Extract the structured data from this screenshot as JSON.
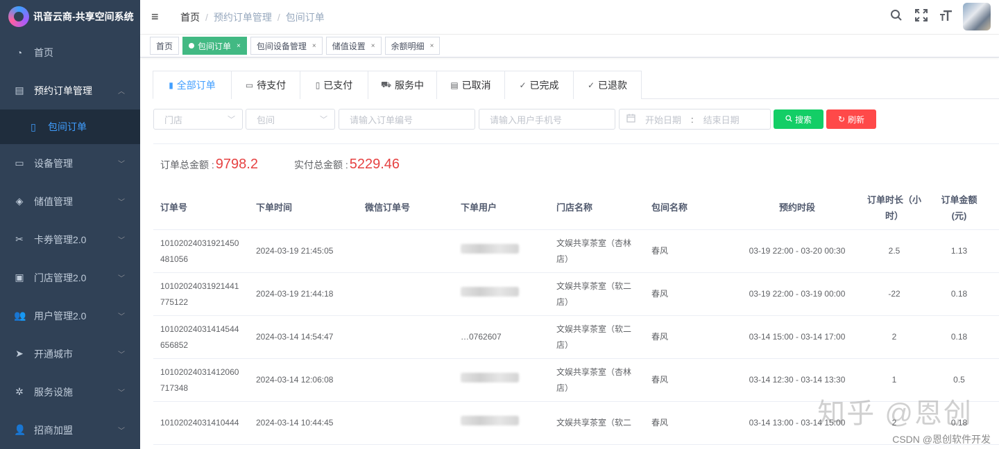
{
  "app": {
    "title": "讯音云商-共享空间系统"
  },
  "sidebar": {
    "items": [
      {
        "label": "首页",
        "icon": "dashboard-icon",
        "glyph": "◔"
      },
      {
        "label": "预约订单管理",
        "icon": "order-icon",
        "glyph": "▤",
        "open": true
      },
      {
        "label": "设备管理",
        "icon": "device-icon",
        "glyph": "▭"
      },
      {
        "label": "储值管理",
        "icon": "wallet-icon",
        "glyph": "◈"
      },
      {
        "label": "卡券管理2.0",
        "icon": "coupon-icon",
        "glyph": "✂"
      },
      {
        "label": "门店管理2.0",
        "icon": "store-icon",
        "glyph": "▣"
      },
      {
        "label": "用户管理2.0",
        "icon": "user-icon",
        "glyph": "👥"
      },
      {
        "label": "开通城市",
        "icon": "send-icon",
        "glyph": "➤"
      },
      {
        "label": "服务设施",
        "icon": "gear-icon",
        "glyph": "✲"
      },
      {
        "label": "招商加盟",
        "icon": "people-icon",
        "glyph": "👤"
      }
    ],
    "sub_item": {
      "label": "包间订单",
      "icon": "book-icon",
      "glyph": "▯"
    }
  },
  "header": {
    "breadcrumb": [
      "首页",
      "预约订单管理",
      "包间订单"
    ],
    "icons": [
      "search-icon",
      "fullscreen-icon",
      "font-size-icon"
    ]
  },
  "tags": [
    {
      "label": "首页",
      "active": false,
      "closable": false
    },
    {
      "label": "包间订单",
      "active": true,
      "closable": true
    },
    {
      "label": "包间设备管理",
      "active": false,
      "closable": true
    },
    {
      "label": "储值设置",
      "active": false,
      "closable": true
    },
    {
      "label": "余额明细",
      "active": false,
      "closable": true
    }
  ],
  "status_tabs": [
    {
      "label": "全部订单",
      "icon": "clipboard-icon",
      "glyph": "▮",
      "active": true
    },
    {
      "label": "待支付",
      "icon": "card-icon",
      "glyph": "▭"
    },
    {
      "label": "已支付",
      "icon": "receipt-icon",
      "glyph": "▯"
    },
    {
      "label": "服务中",
      "icon": "truck-icon",
      "glyph": "⛟"
    },
    {
      "label": "已取消",
      "icon": "document-icon",
      "glyph": "▤"
    },
    {
      "label": "已完成",
      "icon": "check-circle-icon",
      "glyph": "✓"
    },
    {
      "label": "已退款",
      "icon": "check-circle-icon",
      "glyph": "✓"
    }
  ],
  "filters": {
    "store_placeholder": "门店",
    "room_placeholder": "包间",
    "order_no_placeholder": "请输入订单编号",
    "phone_placeholder": "请输入用户手机号",
    "start_date_placeholder": "开始日期",
    "date_separator": ":",
    "end_date_placeholder": "结束日期",
    "search_label": "搜索",
    "refresh_label": "刷新"
  },
  "totals": {
    "order_total_label": "订单总金额 :",
    "order_total_value": "9798.2",
    "paid_total_label": "实付总金额 :",
    "paid_total_value": "5229.46"
  },
  "table": {
    "columns": [
      "订单号",
      "下单时间",
      "微信订单号",
      "下单用户",
      "门店名称",
      "包间名称",
      "预约时段",
      "订单时长（小时）",
      "订单金额(元)"
    ],
    "rows": [
      {
        "order_no": "10102024031921450481056",
        "time": "2024-03-19 21:45:05",
        "wx_no": "",
        "user": "",
        "store": "文娱共享茶室（杏林店）",
        "room": "春风",
        "slot": "03-19 22:00 - 03-20 00:30",
        "hours": "2.5",
        "amount": "1.13"
      },
      {
        "order_no": "10102024031921441775122",
        "time": "2024-03-19 21:44:18",
        "wx_no": "",
        "user": "",
        "store": "文娱共享茶室（软二店）",
        "room": "春风",
        "slot": "03-19 22:00 - 03-19 00:00",
        "hours": "-22",
        "amount": "0.18"
      },
      {
        "order_no": "10102024031414544656852",
        "time": "2024-03-14 14:54:47",
        "wx_no": "",
        "user": "…0762607",
        "store": "文娱共享茶室（软二店）",
        "room": "春风",
        "slot": "03-14 15:00 - 03-14 17:00",
        "hours": "2",
        "amount": "0.18"
      },
      {
        "order_no": "10102024031412060717348",
        "time": "2024-03-14 12:06:08",
        "wx_no": "",
        "user": "",
        "store": "文娱共享茶室（杏林店）",
        "room": "春风",
        "slot": "03-14 12:30 - 03-14 13:30",
        "hours": "1",
        "amount": "0.5"
      },
      {
        "order_no": "10102024031410444",
        "time": "2024-03-14 10:44:45",
        "wx_no": "",
        "user": "",
        "store": "文娱共享茶室（软二",
        "room": "春风",
        "slot": "03-14 13:00 - 03-14 15:00",
        "hours": "2",
        "amount": "0.18"
      }
    ]
  },
  "watermark": "知乎 @恩创",
  "csdn_credit": "CSDN @恩创软件开发"
}
